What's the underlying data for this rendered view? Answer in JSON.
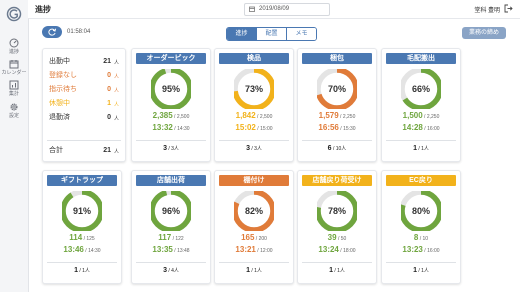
{
  "colors": {
    "blue": "#4a78b2",
    "orange": "#e07b39",
    "yellow": "#f2b21b",
    "green": "#6fa53e",
    "nav_bg": "#f4f5f7",
    "track": "#e4e4e4"
  },
  "header": {
    "title": "進捗",
    "date": "2019/08/09",
    "user": "堂科 豊明"
  },
  "nav": [
    {
      "label": "進捗",
      "icon": "gauge-icon"
    },
    {
      "label": "カレンダー",
      "icon": "calendar-icon"
    },
    {
      "label": "集計",
      "icon": "chart-icon"
    },
    {
      "label": "設定",
      "icon": "gear-icon"
    }
  ],
  "toolbar": {
    "timer": "01:58:04",
    "tabs": [
      "進捗",
      "配置",
      "メモ"
    ],
    "active_tab": 0,
    "summary_button": "業務の締め"
  },
  "status": {
    "rows": [
      {
        "label": "出勤中",
        "value": "21",
        "unit": "人",
        "color": "#222222"
      },
      {
        "label": "登録なし",
        "value": "0",
        "unit": "人",
        "color": "#e07b39"
      },
      {
        "label": "指示待ち",
        "value": "0",
        "unit": "人",
        "color": "#e07b39"
      },
      {
        "label": "休憩中",
        "value": "1",
        "unit": "人",
        "color": "#f2b21b"
      },
      {
        "label": "退勤済",
        "value": "0",
        "unit": "人",
        "color": "#222222"
      }
    ],
    "total_label": "合計",
    "total_value": "21",
    "total_unit": "人"
  },
  "processes": [
    {
      "name": "オーダーピック",
      "color": "#4a78b2",
      "percent": 95,
      "pct_label": "95%",
      "done": "2,385",
      "target": "2,500",
      "time": "13:32",
      "target_time": "14:30",
      "people": "3",
      "people_total": "3人",
      "ring": "#6fa53e",
      "qty_color": "#6fa53e",
      "time_color": "#6fa53e"
    },
    {
      "name": "検品",
      "color": "#4a78b2",
      "percent": 73,
      "pct_label": "73%",
      "done": "1,842",
      "target": "2,500",
      "time": "15:02",
      "target_time": "15:00",
      "people": "3",
      "people_total": "3人",
      "ring": "#f2b21b",
      "qty_color": "#f2b21b",
      "time_color": "#f2b21b"
    },
    {
      "name": "梱包",
      "color": "#4a78b2",
      "percent": 70,
      "pct_label": "70%",
      "done": "1,579",
      "target": "2,250",
      "time": "16:56",
      "target_time": "15:30",
      "people": "6",
      "people_total": "10人",
      "ring": "#e07b39",
      "qty_color": "#e07b39",
      "time_color": "#e07b39"
    },
    {
      "name": "毛配搬出",
      "color": "#4a78b2",
      "percent": 66,
      "pct_label": "66%",
      "done": "1,500",
      "target": "2,250",
      "time": "14:28",
      "target_time": "16:00",
      "people": "1",
      "people_total": "1人",
      "ring": "#6fa53e",
      "qty_color": "#6fa53e",
      "time_color": "#6fa53e"
    },
    {
      "name": "ギフトラップ",
      "color": "#4a78b2",
      "percent": 91,
      "pct_label": "91%",
      "done": "114",
      "target": "125",
      "time": "13:46",
      "target_time": "14:30",
      "people": "1",
      "people_total": "1人",
      "ring": "#6fa53e",
      "qty_color": "#6fa53e",
      "time_color": "#6fa53e"
    },
    {
      "name": "店舗出荷",
      "color": "#4a78b2",
      "percent": 96,
      "pct_label": "96%",
      "done": "117",
      "target": "122",
      "time": "13:35",
      "target_time": "13:48",
      "people": "3",
      "people_total": "4人",
      "ring": "#6fa53e",
      "qty_color": "#6fa53e",
      "time_color": "#6fa53e"
    },
    {
      "name": "棚付け",
      "color": "#e07b39",
      "percent": 82,
      "pct_label": "82%",
      "done": "165",
      "target": "200",
      "time": "13:21",
      "target_time": "12:00",
      "people": "1",
      "people_total": "1人",
      "ring": "#e07b39",
      "qty_color": "#e07b39",
      "time_color": "#e07b39"
    },
    {
      "name": "店舗戻り荷受け",
      "color": "#f2b21b",
      "percent": 78,
      "pct_label": "78%",
      "done": "39",
      "target": "50",
      "time": "13:24",
      "target_time": "18:00",
      "people": "1",
      "people_total": "1人",
      "ring": "#6fa53e",
      "qty_color": "#6fa53e",
      "time_color": "#6fa53e"
    },
    {
      "name": "EC戻り",
      "color": "#f2b21b",
      "percent": 80,
      "pct_label": "80%",
      "done": "8",
      "target": "10",
      "time": "13:23",
      "target_time": "16:00",
      "people": "1",
      "people_total": "1人",
      "ring": "#6fa53e",
      "qty_color": "#6fa53e",
      "time_color": "#6fa53e"
    }
  ]
}
